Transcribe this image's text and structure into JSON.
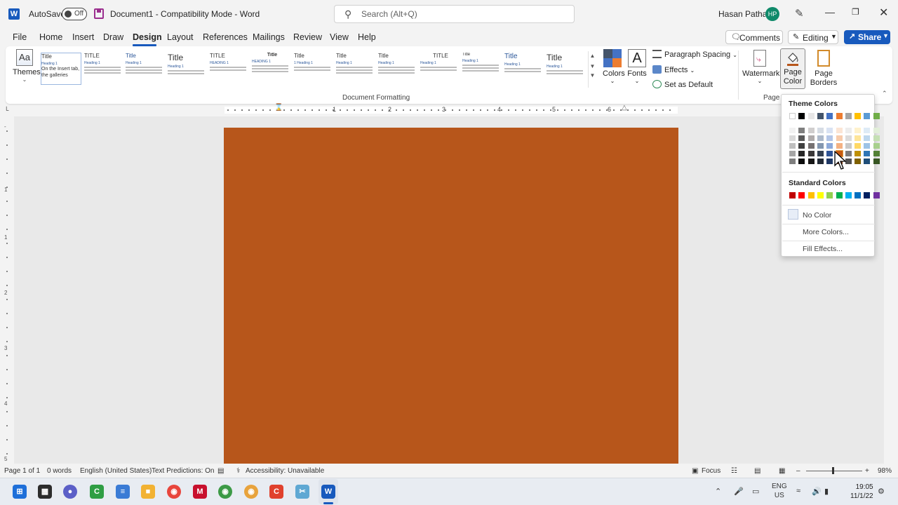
{
  "titlebar": {
    "autosave_label": "AutoSave",
    "autosave_state": "Off",
    "document_title": "Document1  -  Compatibility Mode  -  Word",
    "search_placeholder": "Search (Alt+Q)",
    "user_name": "Hasan Pathan",
    "user_initials": "HP"
  },
  "tabs": [
    "File",
    "Home",
    "Insert",
    "Draw",
    "Design",
    "Layout",
    "References",
    "Mailings",
    "Review",
    "View",
    "Help"
  ],
  "active_tab": "Design",
  "header_buttons": {
    "comments": "Comments",
    "editing": "Editing",
    "share": "Share"
  },
  "ribbon": {
    "themes_label": "Themes",
    "style_gallery": [
      {
        "title": "Title",
        "heading": "Heading 1",
        "body": "On the Insert tab, the galleries"
      },
      {
        "title": "TITLE",
        "heading": "Heading 1",
        "body": ""
      },
      {
        "title": "Title",
        "heading": "Heading 1",
        "body": ""
      },
      {
        "title": "Title",
        "heading": "Heading 1",
        "body": ""
      },
      {
        "title": "TITLE",
        "heading": "HEADING 1",
        "body": ""
      },
      {
        "title": "Title",
        "heading": "HEADING 1",
        "body": ""
      },
      {
        "title": "Title",
        "heading": "1  Heading 1",
        "body": ""
      },
      {
        "title": "Title",
        "heading": "Heading 1",
        "body": ""
      },
      {
        "title": "Title",
        "heading": "Heading 1",
        "body": ""
      },
      {
        "title": "TITLE",
        "heading": "Heading 1",
        "body": ""
      },
      {
        "title": "Title",
        "heading": "Heading 1",
        "body": ""
      },
      {
        "title": "Title",
        "heading": "Heading 1",
        "body": ""
      },
      {
        "title": "Title",
        "heading": "Heading 1",
        "body": ""
      }
    ],
    "colors_label": "Colors",
    "fonts_label": "Fonts",
    "paragraph_spacing_label": "Paragraph Spacing",
    "effects_label": "Effects",
    "set_default_label": "Set as Default",
    "document_formatting_label": "Document Formatting",
    "watermark_label": "Watermark",
    "page_color_label": "Page Color",
    "page_borders_label": "Page Borders",
    "page_background_label": "Page B"
  },
  "ruler_numbers": [
    "1",
    "2",
    "3",
    "4",
    "5",
    "6"
  ],
  "vruler_numbers": [
    "1",
    "1",
    "2",
    "3",
    "4",
    "5"
  ],
  "page_background_color": "#b7561b",
  "page_color_menu": {
    "theme_colors_heading": "Theme Colors",
    "theme_colors": [
      "#ffffff",
      "#000000",
      "#e7e6e6",
      "#44546a",
      "#4472c4",
      "#ed7d31",
      "#a5a5a5",
      "#ffc000",
      "#5b9bd5",
      "#70ad47"
    ],
    "theme_shades": [
      [
        "#f2f2f2",
        "#d9d9d9",
        "#bfbfbf",
        "#a6a6a6",
        "#7f7f7f"
      ],
      [
        "#7f7f7f",
        "#595959",
        "#404040",
        "#262626",
        "#0d0d0d"
      ],
      [
        "#d0cece",
        "#afabab",
        "#767171",
        "#3a3838",
        "#171616"
      ],
      [
        "#d6dce4",
        "#adb9ca",
        "#8497b0",
        "#333f4f",
        "#222a35"
      ],
      [
        "#d9e2f3",
        "#b4c6e7",
        "#8eaadb",
        "#2f5496",
        "#1f3864"
      ],
      [
        "#fbe5d5",
        "#f7cbac",
        "#f4b183",
        "#c55a11",
        "#833c0b"
      ],
      [
        "#ededed",
        "#dbdbdb",
        "#c9c9c9",
        "#7b7b7b",
        "#525252"
      ],
      [
        "#fff2cc",
        "#fee599",
        "#ffd965",
        "#bf9000",
        "#7f6000"
      ],
      [
        "#deebf6",
        "#bdd7ee",
        "#9dc3e6",
        "#2e75b5",
        "#1f4e79"
      ],
      [
        "#e2efd9",
        "#c5e0b3",
        "#a8d08d",
        "#538135",
        "#375623"
      ]
    ],
    "standard_colors_heading": "Standard Colors",
    "standard_colors": [
      "#c00000",
      "#ff0000",
      "#ffc000",
      "#ffff00",
      "#92d050",
      "#00b050",
      "#00b0f0",
      "#0070c0",
      "#002060",
      "#7030a0"
    ],
    "no_color_label": "No Color",
    "more_colors_label": "More Colors...",
    "fill_effects_label": "Fill Effects..."
  },
  "statusbar": {
    "page": "Page 1 of 1",
    "words": "0 words",
    "language": "English (United States)",
    "text_predictions": "Text Predictions: On",
    "accessibility": "Accessibility: Unavailable",
    "focus": "Focus",
    "zoom": "98%"
  },
  "taskbar": {
    "language_line1": "ENG",
    "language_line2": "US",
    "time": "19:05",
    "date": "11/1/22"
  }
}
